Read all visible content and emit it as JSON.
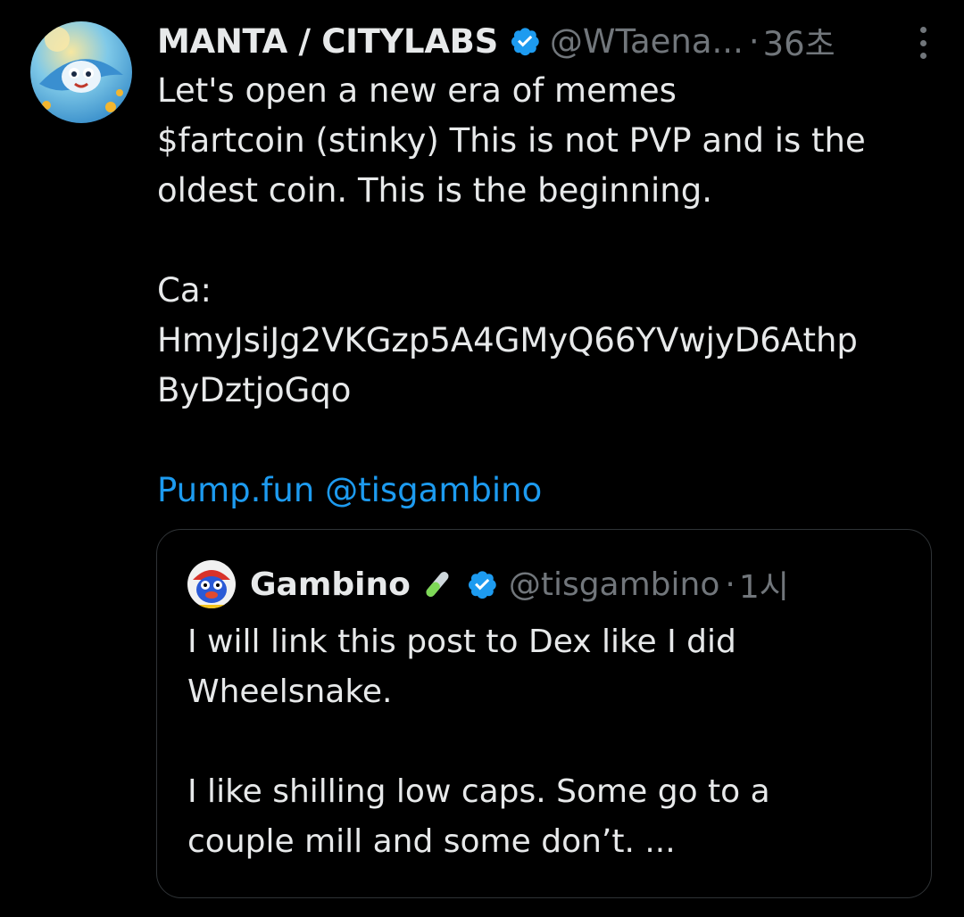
{
  "tweet": {
    "author_name": "MANTA / CITYLABS",
    "handle": "@WTaena...",
    "separator": "·",
    "time": "36초",
    "lines": [
      "Let's open a new era of memes",
      "$fartcoin (stinky) This is not PVP and is the",
      "oldest coin. This is the beginning.",
      "",
      "Ca:",
      "HmyJsiJg2VKGzp5A4GMyQ66YVwjyD6Athp",
      "ByDztjoGqo",
      ""
    ],
    "link_1": "Pump.fun",
    "link_2": "@tisgambino",
    "colors": {
      "accent": "#1d9bf0",
      "text": "#e7e9ea",
      "muted": "#71767b",
      "border": "#2f3336",
      "background": "#000000"
    },
    "icons": [
      "avatar-manta",
      "verified-badge-icon",
      "more-options-icon"
    ]
  },
  "quoted_tweet": {
    "author_name": "Gambino",
    "emoji": "test-tube-icon",
    "handle": "@tisgambino",
    "separator": "·",
    "time": "1시",
    "lines": [
      "I will link this post to Dex like I did",
      "Wheelsnake.",
      "",
      "I like shilling low caps. Some go to a",
      "couple mill and some don’t. ..."
    ]
  }
}
